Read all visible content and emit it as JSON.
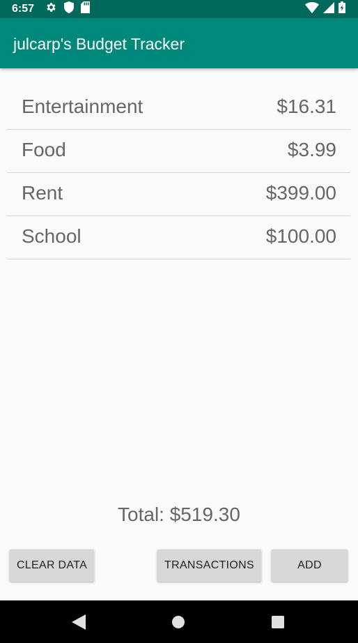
{
  "status_bar": {
    "time": "6:57",
    "left_icons": [
      "gear-icon",
      "shield-icon",
      "sd-card-icon"
    ],
    "right_icons": [
      "wifi-icon",
      "signal-icon",
      "battery-icon"
    ],
    "background_color": "#00695c"
  },
  "app_bar": {
    "title": "julcarp's Budget Tracker",
    "color": "#00897b"
  },
  "categories": [
    {
      "name": "Entertainment",
      "amount": "$16.31"
    },
    {
      "name": "Food",
      "amount": "$3.99"
    },
    {
      "name": "Rent",
      "amount": "$399.00"
    },
    {
      "name": "School",
      "amount": "$100.00"
    }
  ],
  "total": "Total: $519.30",
  "buttons": {
    "clear": "CLEAR DATA",
    "transactions": "TRANSACTIONS",
    "add": "ADD"
  },
  "nav_bar": {
    "buttons": [
      "back-icon",
      "home-icon",
      "recents-icon"
    ]
  }
}
